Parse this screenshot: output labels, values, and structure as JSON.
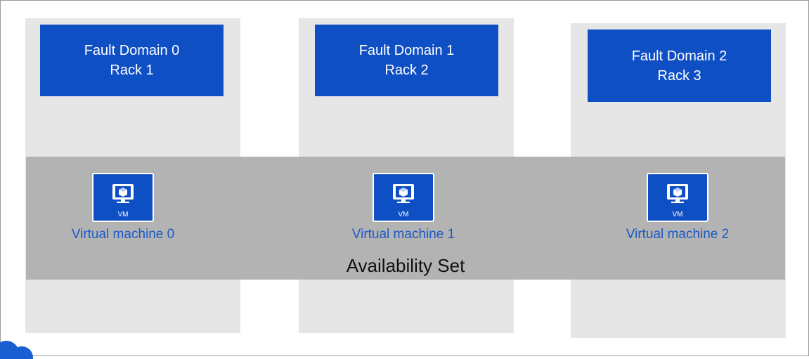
{
  "fault_domains": [
    {
      "name": "Fault Domain 0",
      "rack": "Rack 1"
    },
    {
      "name": "Fault Domain 1",
      "rack": "Rack 2"
    },
    {
      "name": "Fault Domain 2",
      "rack": "Rack 3"
    }
  ],
  "availability_set": {
    "label": "Availability Set"
  },
  "vms": [
    {
      "label": "Virtual machine 0",
      "badge": "VM"
    },
    {
      "label": "Virtual machine 1",
      "badge": "VM"
    },
    {
      "label": "Virtual machine 2",
      "badge": "VM"
    }
  ],
  "colors": {
    "fault_domain_fill": "#0f4fc4",
    "column_fill": "#e6e6e6",
    "availability_band": "#b3b3b3",
    "vm_label": "#1a59c7"
  }
}
